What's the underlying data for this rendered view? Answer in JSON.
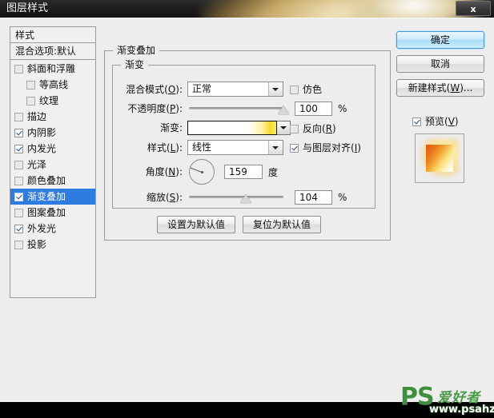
{
  "window": {
    "title": "图层样式",
    "close_label": "x"
  },
  "style_list": {
    "header": "样式",
    "blending_options": "混合选项:默认",
    "items": [
      {
        "label": "斜面和浮雕",
        "checked": false,
        "indent": false,
        "selected": false
      },
      {
        "label": "等高线",
        "checked": false,
        "indent": true,
        "selected": false
      },
      {
        "label": "纹理",
        "checked": false,
        "indent": true,
        "selected": false
      },
      {
        "label": "描边",
        "checked": false,
        "indent": false,
        "selected": false
      },
      {
        "label": "内阴影",
        "checked": true,
        "indent": false,
        "selected": false
      },
      {
        "label": "内发光",
        "checked": true,
        "indent": false,
        "selected": false
      },
      {
        "label": "光泽",
        "checked": false,
        "indent": false,
        "selected": false
      },
      {
        "label": "颜色叠加",
        "checked": false,
        "indent": false,
        "selected": false
      },
      {
        "label": "渐变叠加",
        "checked": true,
        "indent": false,
        "selected": true
      },
      {
        "label": "图案叠加",
        "checked": false,
        "indent": false,
        "selected": false
      },
      {
        "label": "外发光",
        "checked": true,
        "indent": false,
        "selected": false
      },
      {
        "label": "投影",
        "checked": false,
        "indent": false,
        "selected": false
      }
    ],
    "selected_color": "#2f7ce0"
  },
  "panel": {
    "group_title": "渐变叠加",
    "subgroup_title": "渐变",
    "blend_mode": {
      "label_pre": "混合模式(",
      "label_key": "O",
      "label_post": "):",
      "value": "正常"
    },
    "dither": {
      "label": "仿色",
      "checked": false
    },
    "opacity": {
      "label_pre": "不透明度(",
      "label_key": "P",
      "label_post": "):",
      "value": "100",
      "unit": "%",
      "percent": 100
    },
    "gradient": {
      "label": "渐变:",
      "start_color": "#ffffff",
      "end_color": "#f5dc2a"
    },
    "reverse": {
      "label_pre": "反向(",
      "label_key": "R",
      "label_post": ")",
      "checked": false
    },
    "style": {
      "label_pre": "样式(",
      "label_key": "L",
      "label_post": "):",
      "value": "线性"
    },
    "align_with_layer": {
      "label_pre": "与图层对齐(",
      "label_key": "I",
      "label_post": ")",
      "checked": true
    },
    "angle": {
      "label_pre": "角度(",
      "label_key": "N",
      "label_post": "):",
      "value": "159",
      "unit": "度",
      "degrees": 159
    },
    "scale": {
      "label_pre": "缩放(",
      "label_key": "S",
      "label_post": "):",
      "value": "104",
      "unit": "%",
      "percent": 60
    },
    "make_default_button": "设置为默认值",
    "reset_default_button": "复位为默认值"
  },
  "actions": {
    "ok": "确定",
    "cancel": "取消",
    "new_style_pre": "新建样式(",
    "new_style_key": "W",
    "new_style_post": ")...",
    "preview_pre": "预览(",
    "preview_key": "V",
    "preview_post": ")",
    "preview_checked": true,
    "ok_accent": "#a9dcf7"
  },
  "watermark": {
    "logo": "PS",
    "chinese": "爱好者",
    "url": "www.psahz.com",
    "color": "#3f8f3f"
  }
}
